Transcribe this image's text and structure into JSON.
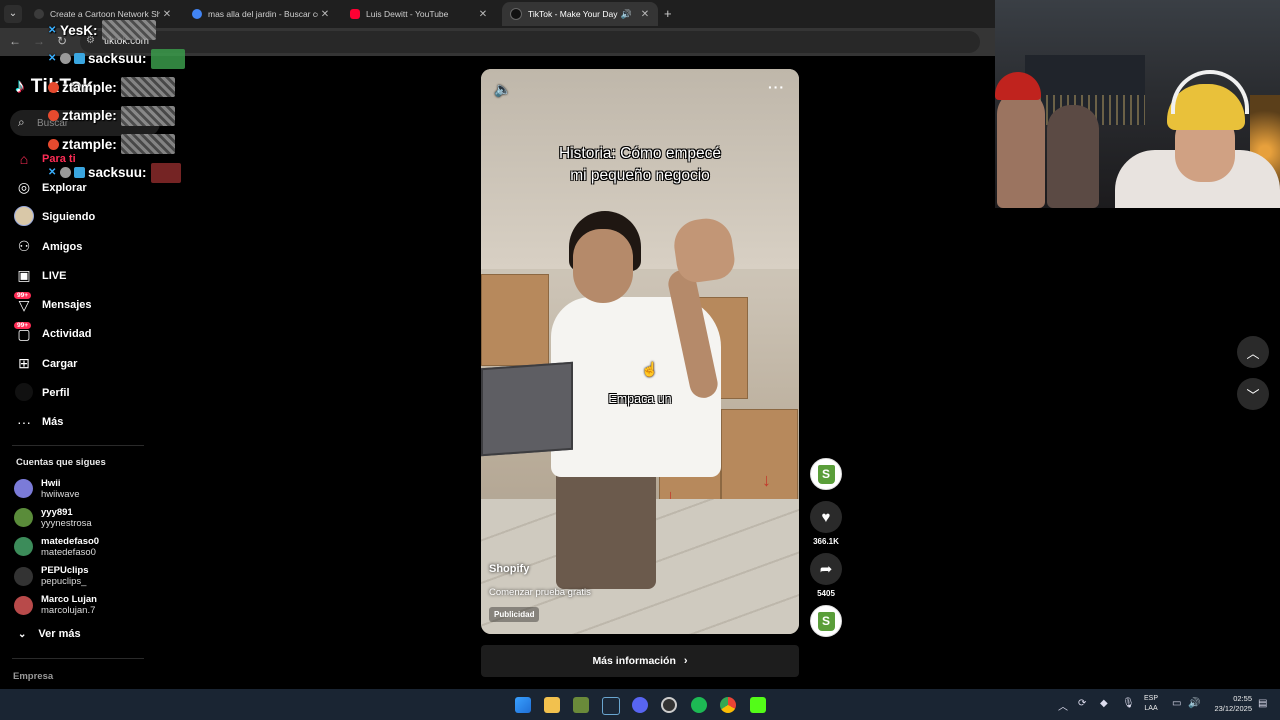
{
  "browser": {
    "tabs": [
      {
        "title": "Create a Cartoon Network Show",
        "favicon_color": "#3b3b3b",
        "active": false
      },
      {
        "title": "mas alla del jardin - Buscar con",
        "favicon_color": "#4285f4",
        "active": false
      },
      {
        "title": "Luis Dewitt - YouTube",
        "favicon_color": "#ff0033",
        "active": false
      },
      {
        "title": "TikTok - Make Your Day",
        "favicon_color": "#111111",
        "active": true
      }
    ],
    "url": "tiktok.com"
  },
  "chat_overlay": {
    "messages": [
      {
        "user": "YesK:",
        "color": "#ffffff"
      },
      {
        "user": "sacksuu:",
        "color": "#ffffff"
      },
      {
        "user": "ztample:",
        "color": "#ffffff"
      },
      {
        "user": "ztample:",
        "color": "#ffffff"
      },
      {
        "user": "ztample:",
        "color": "#ffffff"
      },
      {
        "user": "sacksuu:",
        "color": "#ffffff"
      }
    ]
  },
  "sidebar": {
    "logo": "TikTok",
    "search_placeholder": "Buscar",
    "nav": [
      {
        "label": "Para ti",
        "icon": "home-icon",
        "active": true
      },
      {
        "label": "Explorar",
        "icon": "compass-icon"
      },
      {
        "label": "Siguiendo",
        "icon": "following-avatar-icon"
      },
      {
        "label": "Amigos",
        "icon": "friends-icon"
      },
      {
        "label": "LIVE",
        "icon": "live-icon"
      },
      {
        "label": "Mensajes",
        "icon": "messages-icon",
        "badge": "99+"
      },
      {
        "label": "Actividad",
        "icon": "activity-icon",
        "badge": "99+"
      },
      {
        "label": "Cargar",
        "icon": "upload-icon"
      },
      {
        "label": "Perfil",
        "icon": "profile-icon"
      },
      {
        "label": "Más",
        "icon": "more-icon"
      }
    ],
    "following_title": "Cuentas que sigues",
    "following": [
      {
        "name": "Hwii",
        "handle": "hwiiwave",
        "color": "#7b7bd8"
      },
      {
        "name": "yyy891",
        "handle": "yyynestrosa",
        "color": "#5a8c3a"
      },
      {
        "name": "matedefaso0",
        "handle": "matedefaso0",
        "color": "#3c8c5a"
      },
      {
        "name": "PEPUclips",
        "handle": "pepuclips_",
        "color": "#333333"
      },
      {
        "name": "Marco Lujan",
        "handle": "marcolujan.7",
        "color": "#b84a4a"
      }
    ],
    "see_more": "Ver más",
    "footer": "Empresa"
  },
  "video": {
    "caption_line1": "Historia: Cómo empecé",
    "caption_line2": "mi pequeño negocio",
    "subtitle": "Empaca un",
    "author": "Shopify",
    "cta": "Comenzar prueba gratis",
    "ad_label": "Publicidad",
    "more_info": "Más información",
    "likes": "366.1K",
    "shares": "5405"
  },
  "taskbar": {
    "lang_line1": "ESP",
    "lang_line2": "LAA",
    "time": "02:55",
    "date": "23/12/2025"
  }
}
